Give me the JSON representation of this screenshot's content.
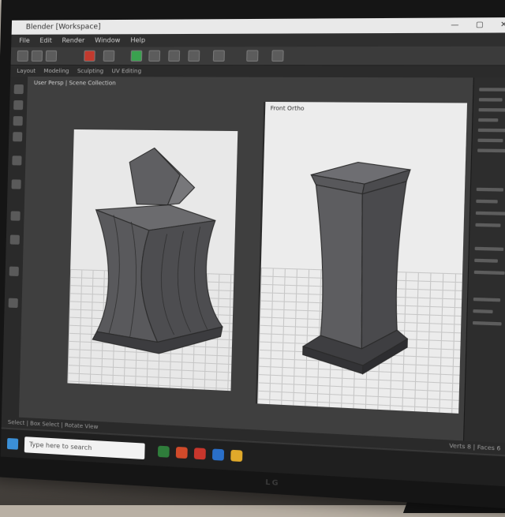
{
  "window": {
    "title": "Blender [Workspace]",
    "controls": "— ▢ ✕"
  },
  "menubar": {
    "items": [
      "File",
      "Edit",
      "Render",
      "Window",
      "Help"
    ]
  },
  "tabs": {
    "items": [
      "Layout",
      "Modeling",
      "Sculpting",
      "UV Editing"
    ]
  },
  "viewport": {
    "left_label": "User Persp | Scene Collection",
    "right_label": "Front Ortho"
  },
  "statusbar": {
    "left": "Select  |  Box Select  |  Rotate View",
    "right": "Verts 8 | Faces 6"
  },
  "taskbar": {
    "search_placeholder": "Type here to search"
  },
  "monitor": {
    "brand": "LG"
  },
  "colors": {
    "accent_green": "#3aa14f",
    "accent_red": "#c23a2e",
    "start_blue": "#3b8fd6"
  }
}
